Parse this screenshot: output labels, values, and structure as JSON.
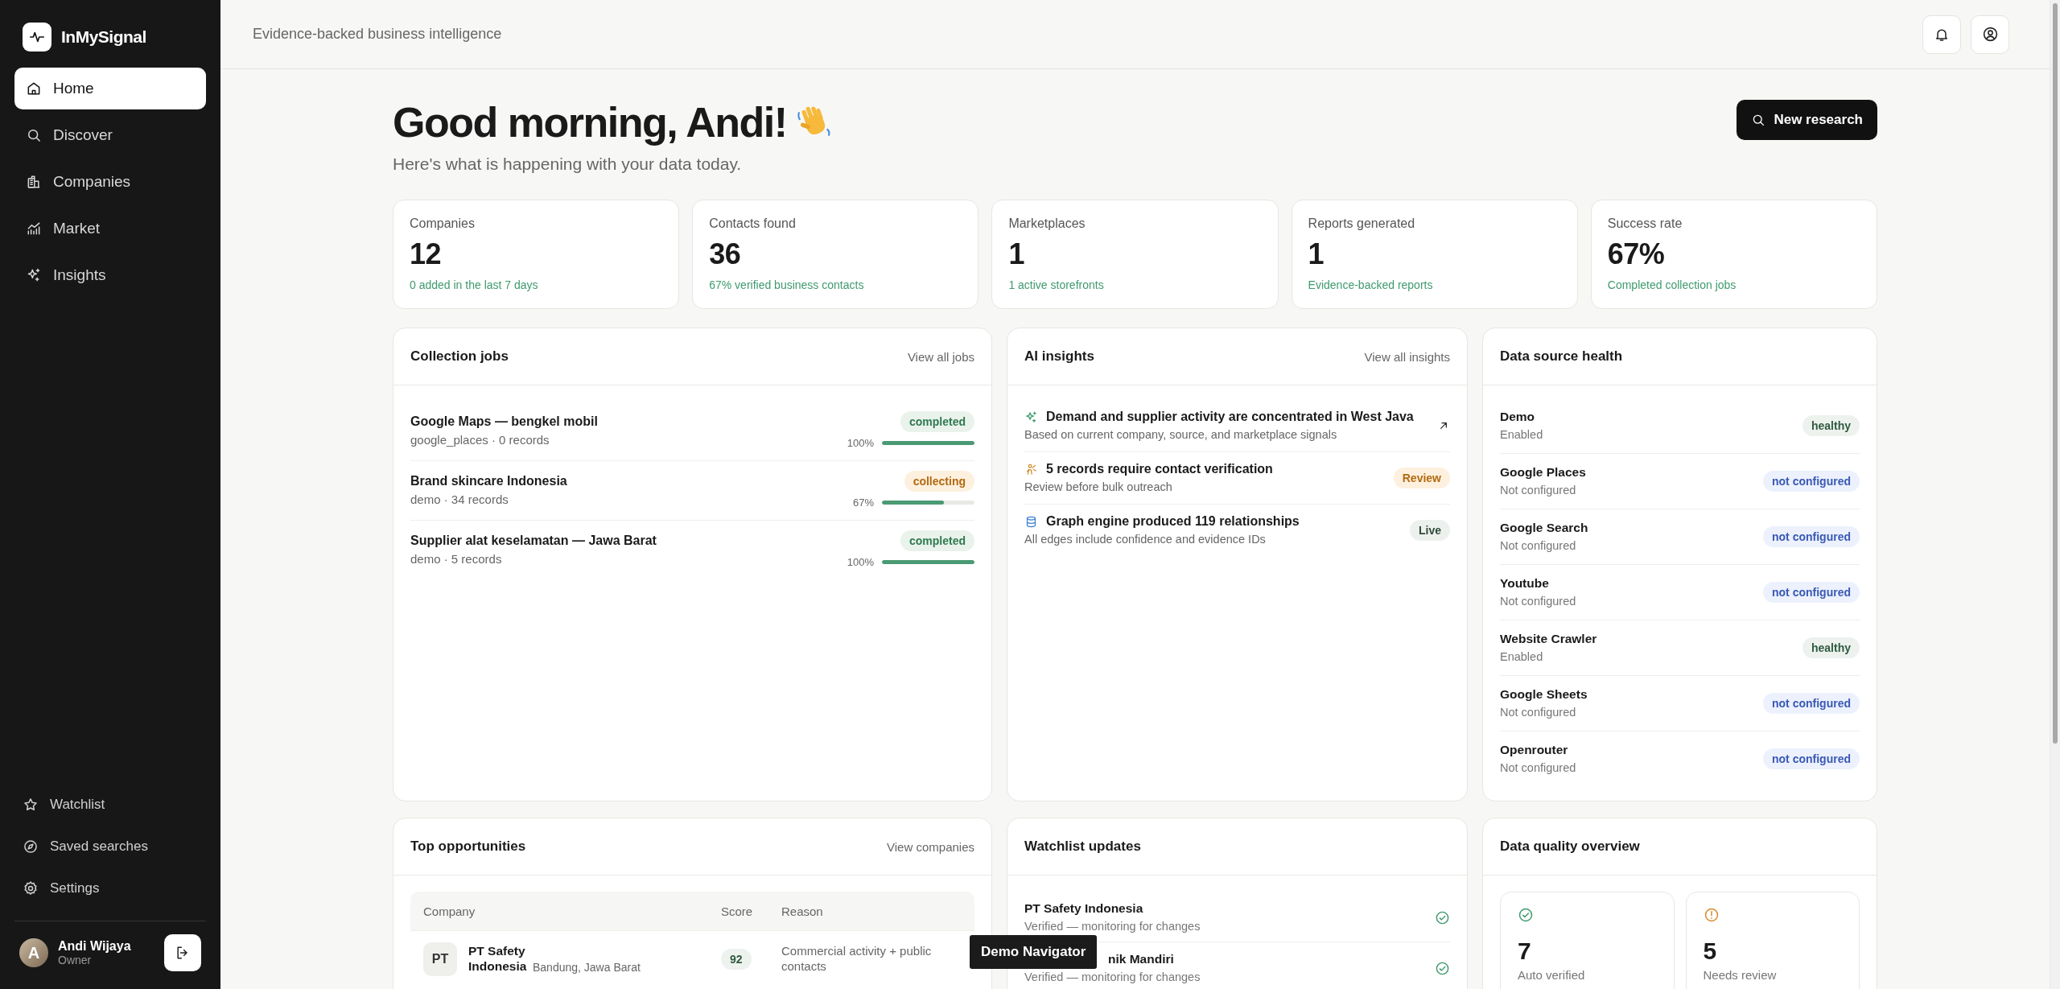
{
  "brand": {
    "name": "InMySignal"
  },
  "nav": [
    {
      "label": "Home",
      "selected": true
    },
    {
      "label": "Discover",
      "selected": false
    },
    {
      "label": "Companies",
      "selected": false
    },
    {
      "label": "Market",
      "selected": false
    },
    {
      "label": "Insights",
      "selected": false
    }
  ],
  "nav_bottom": [
    {
      "label": "Watchlist"
    },
    {
      "label": "Saved searches"
    },
    {
      "label": "Settings"
    }
  ],
  "user": {
    "initial": "A",
    "name": "Andi Wijaya",
    "role": "Owner"
  },
  "topbar": {
    "tagline": "Evidence-backed business intelligence"
  },
  "greeting": {
    "title": "Good morning, Andi!",
    "subtitle": "Here's what is happening with your data today."
  },
  "new_research_button": "New research",
  "stats": [
    {
      "label": "Companies",
      "value": "12",
      "note": "0 added in the last 7 days"
    },
    {
      "label": "Contacts found",
      "value": "36",
      "note": "67% verified business contacts"
    },
    {
      "label": "Marketplaces",
      "value": "1",
      "note": "1 active storefronts"
    },
    {
      "label": "Reports generated",
      "value": "1",
      "note": "Evidence-backed reports"
    },
    {
      "label": "Success rate",
      "value": "67%",
      "note": "Completed collection jobs"
    }
  ],
  "collection_jobs": {
    "title": "Collection jobs",
    "link": "View all jobs",
    "jobs": [
      {
        "name": "Google Maps — bengkel mobil",
        "meta": "google_places · 0 records",
        "status": "completed",
        "kind": "completed",
        "percent": "100%",
        "level": 1
      },
      {
        "name": "Brand skincare Indonesia",
        "meta": "demo · 34 records",
        "status": "collecting",
        "kind": "collecting",
        "percent": "67%",
        "level": 0.67
      },
      {
        "name": "Supplier alat keselamatan — Jawa Barat",
        "meta": "demo · 5 records",
        "status": "completed",
        "kind": "completed",
        "percent": "100%",
        "level": 1
      }
    ]
  },
  "ai_insights": {
    "title": "AI insights",
    "link": "View all insights",
    "items": [
      {
        "title": "Demand and supplier activity are concentrated in West Java",
        "text": "Based on current company, source, and marketplace signals",
        "kind": "link"
      },
      {
        "title": "5 records require contact verification",
        "text": "Review before bulk outreach",
        "kind": "warning",
        "badge": "Review"
      },
      {
        "title": "Graph engine produced 119 relationships",
        "text": "All edges include confidence and evidence IDs",
        "kind": "neutral",
        "badge": "Live"
      }
    ]
  },
  "data_sources": {
    "title": "Data source health",
    "sources": [
      {
        "name": "Demo",
        "state": "Enabled",
        "status": "healthy",
        "kind": "healthy"
      },
      {
        "name": "Google Places",
        "state": "Not configured",
        "status": "not configured",
        "kind": "not_configured"
      },
      {
        "name": "Google Search",
        "state": "Not configured",
        "status": "not configured",
        "kind": "not_configured"
      },
      {
        "name": "Youtube",
        "state": "Not configured",
        "status": "not configured",
        "kind": "not_configured"
      },
      {
        "name": "Website Crawler",
        "state": "Enabled",
        "status": "healthy",
        "kind": "healthy"
      },
      {
        "name": "Google Sheets",
        "state": "Not configured",
        "status": "not configured",
        "kind": "not_configured"
      },
      {
        "name": "Openrouter",
        "state": "Not configured",
        "status": "not configured",
        "kind": "not_configured"
      }
    ]
  },
  "top_opportunities": {
    "title": "Top opportunities",
    "link": "View companies",
    "columns": [
      "Company",
      "Score",
      "Reason"
    ],
    "rows": [
      {
        "initials": "PT",
        "name": "PT Safety Indonesia",
        "location": "Bandung, Jawa Barat",
        "score": "92",
        "reason": "Commercial activity + public contacts"
      }
    ]
  },
  "watchlist": {
    "title": "Watchlist updates",
    "items": [
      {
        "name": "PT Safety Indonesia",
        "note": "Verified — monitoring for changes",
        "verified": true
      },
      {
        "name": "nik Mandiri",
        "note": "Verified — monitoring for changes",
        "verified": true
      }
    ]
  },
  "data_quality": {
    "title": "Data quality overview",
    "tiles": [
      {
        "value": "7",
        "label": "Auto verified",
        "kind": "ok"
      },
      {
        "value": "5",
        "label": "Needs review",
        "kind": "warning"
      }
    ]
  },
  "demo_navigator": "Demo Navigator"
}
